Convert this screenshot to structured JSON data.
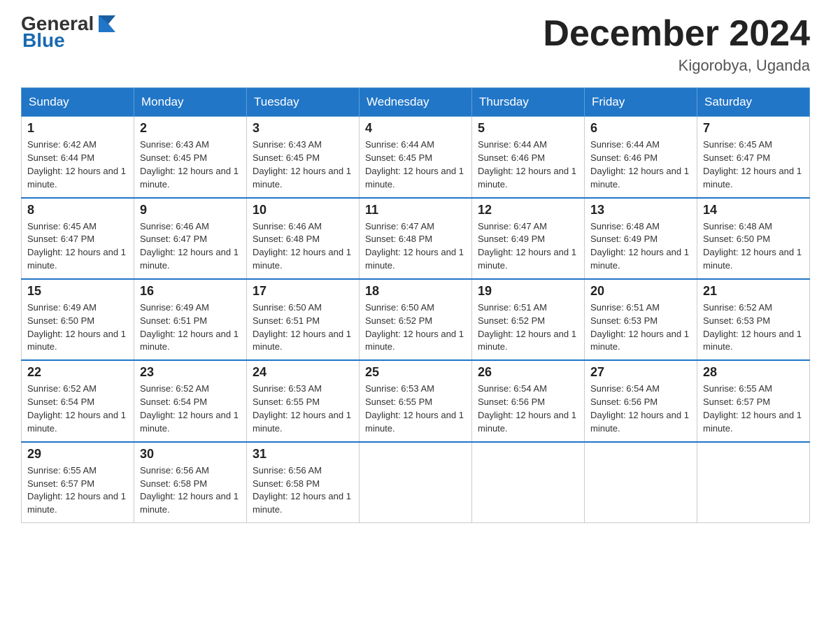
{
  "header": {
    "logo": {
      "text_general": "General",
      "text_blue": "Blue"
    },
    "title": "December 2024",
    "location": "Kigorobya, Uganda"
  },
  "weekdays": [
    "Sunday",
    "Monday",
    "Tuesday",
    "Wednesday",
    "Thursday",
    "Friday",
    "Saturday"
  ],
  "weeks": [
    [
      {
        "day": "1",
        "sunrise": "6:42 AM",
        "sunset": "6:44 PM",
        "daylight": "12 hours and 1 minute."
      },
      {
        "day": "2",
        "sunrise": "6:43 AM",
        "sunset": "6:45 PM",
        "daylight": "12 hours and 1 minute."
      },
      {
        "day": "3",
        "sunrise": "6:43 AM",
        "sunset": "6:45 PM",
        "daylight": "12 hours and 1 minute."
      },
      {
        "day": "4",
        "sunrise": "6:44 AM",
        "sunset": "6:45 PM",
        "daylight": "12 hours and 1 minute."
      },
      {
        "day": "5",
        "sunrise": "6:44 AM",
        "sunset": "6:46 PM",
        "daylight": "12 hours and 1 minute."
      },
      {
        "day": "6",
        "sunrise": "6:44 AM",
        "sunset": "6:46 PM",
        "daylight": "12 hours and 1 minute."
      },
      {
        "day": "7",
        "sunrise": "6:45 AM",
        "sunset": "6:47 PM",
        "daylight": "12 hours and 1 minute."
      }
    ],
    [
      {
        "day": "8",
        "sunrise": "6:45 AM",
        "sunset": "6:47 PM",
        "daylight": "12 hours and 1 minute."
      },
      {
        "day": "9",
        "sunrise": "6:46 AM",
        "sunset": "6:47 PM",
        "daylight": "12 hours and 1 minute."
      },
      {
        "day": "10",
        "sunrise": "6:46 AM",
        "sunset": "6:48 PM",
        "daylight": "12 hours and 1 minute."
      },
      {
        "day": "11",
        "sunrise": "6:47 AM",
        "sunset": "6:48 PM",
        "daylight": "12 hours and 1 minute."
      },
      {
        "day": "12",
        "sunrise": "6:47 AM",
        "sunset": "6:49 PM",
        "daylight": "12 hours and 1 minute."
      },
      {
        "day": "13",
        "sunrise": "6:48 AM",
        "sunset": "6:49 PM",
        "daylight": "12 hours and 1 minute."
      },
      {
        "day": "14",
        "sunrise": "6:48 AM",
        "sunset": "6:50 PM",
        "daylight": "12 hours and 1 minute."
      }
    ],
    [
      {
        "day": "15",
        "sunrise": "6:49 AM",
        "sunset": "6:50 PM",
        "daylight": "12 hours and 1 minute."
      },
      {
        "day": "16",
        "sunrise": "6:49 AM",
        "sunset": "6:51 PM",
        "daylight": "12 hours and 1 minute."
      },
      {
        "day": "17",
        "sunrise": "6:50 AM",
        "sunset": "6:51 PM",
        "daylight": "12 hours and 1 minute."
      },
      {
        "day": "18",
        "sunrise": "6:50 AM",
        "sunset": "6:52 PM",
        "daylight": "12 hours and 1 minute."
      },
      {
        "day": "19",
        "sunrise": "6:51 AM",
        "sunset": "6:52 PM",
        "daylight": "12 hours and 1 minute."
      },
      {
        "day": "20",
        "sunrise": "6:51 AM",
        "sunset": "6:53 PM",
        "daylight": "12 hours and 1 minute."
      },
      {
        "day": "21",
        "sunrise": "6:52 AM",
        "sunset": "6:53 PM",
        "daylight": "12 hours and 1 minute."
      }
    ],
    [
      {
        "day": "22",
        "sunrise": "6:52 AM",
        "sunset": "6:54 PM",
        "daylight": "12 hours and 1 minute."
      },
      {
        "day": "23",
        "sunrise": "6:52 AM",
        "sunset": "6:54 PM",
        "daylight": "12 hours and 1 minute."
      },
      {
        "day": "24",
        "sunrise": "6:53 AM",
        "sunset": "6:55 PM",
        "daylight": "12 hours and 1 minute."
      },
      {
        "day": "25",
        "sunrise": "6:53 AM",
        "sunset": "6:55 PM",
        "daylight": "12 hours and 1 minute."
      },
      {
        "day": "26",
        "sunrise": "6:54 AM",
        "sunset": "6:56 PM",
        "daylight": "12 hours and 1 minute."
      },
      {
        "day": "27",
        "sunrise": "6:54 AM",
        "sunset": "6:56 PM",
        "daylight": "12 hours and 1 minute."
      },
      {
        "day": "28",
        "sunrise": "6:55 AM",
        "sunset": "6:57 PM",
        "daylight": "12 hours and 1 minute."
      }
    ],
    [
      {
        "day": "29",
        "sunrise": "6:55 AM",
        "sunset": "6:57 PM",
        "daylight": "12 hours and 1 minute."
      },
      {
        "day": "30",
        "sunrise": "6:56 AM",
        "sunset": "6:58 PM",
        "daylight": "12 hours and 1 minute."
      },
      {
        "day": "31",
        "sunrise": "6:56 AM",
        "sunset": "6:58 PM",
        "daylight": "12 hours and 1 minute."
      },
      null,
      null,
      null,
      null
    ]
  ]
}
